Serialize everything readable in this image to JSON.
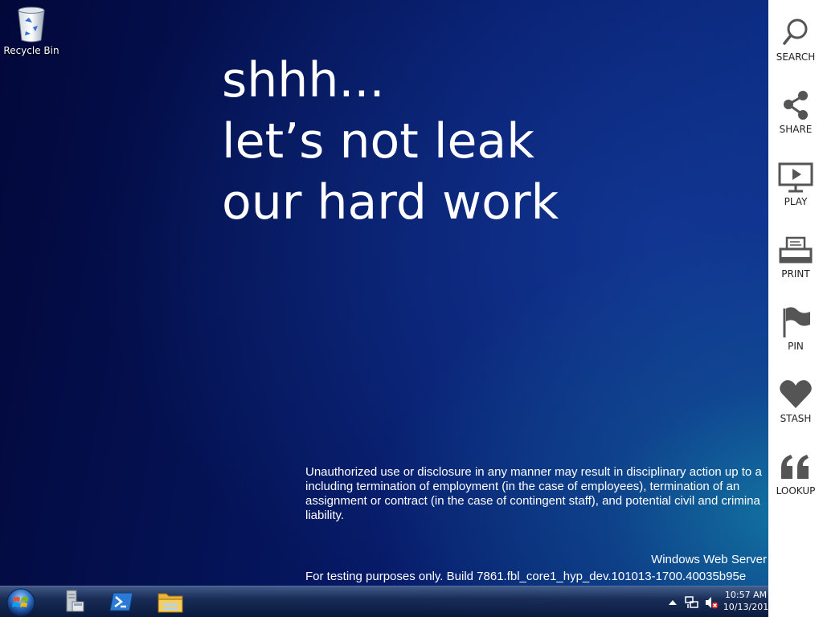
{
  "desktop": {
    "icons": [
      {
        "label": "Recycle Bin",
        "icon": "recycle-bin-icon"
      }
    ]
  },
  "headline": {
    "lines": [
      "shhh...",
      "let’s not leak",
      "our hard work"
    ]
  },
  "disclaimer": {
    "lines": [
      "Unauthorized use or disclosure in any manner may result in disciplinary action up to a",
      "including termination of employment (in the case of employees), termination of an",
      "assignment or contract (in the case of contingent staff), and potential civil and crimina",
      "liability."
    ]
  },
  "watermark": {
    "product": "Windows Web Server",
    "build": "For testing purposes only. Build 7861.fbl_core1_hyp_dev.101013-1700.40035b95e"
  },
  "charms": [
    {
      "label": "SEARCH",
      "icon": "search-icon"
    },
    {
      "label": "SHARE",
      "icon": "share-icon"
    },
    {
      "label": "PLAY",
      "icon": "play-icon"
    },
    {
      "label": "PRINT",
      "icon": "print-icon"
    },
    {
      "label": "PIN",
      "icon": "pin-icon"
    },
    {
      "label": "STASH",
      "icon": "stash-icon"
    },
    {
      "label": "LOOKUP",
      "icon": "lookup-icon"
    }
  ],
  "taskbar": {
    "start": "start-orb-icon",
    "pinned": [
      "server-manager-icon",
      "powershell-icon",
      "file-explorer-icon"
    ],
    "tray": [
      "show-hidden-icons-icon",
      "network-icon",
      "volume-muted-icon"
    ],
    "clock": {
      "time": "10:57 AM",
      "date": "10/13/201"
    }
  },
  "colors": {
    "desktop_dark": "#02083a",
    "desktop_mid": "#061a68",
    "desktop_glow": "#148caa",
    "charms_bg": "#ffffff",
    "charms_icon": "#555555",
    "text": "#ffffff"
  }
}
